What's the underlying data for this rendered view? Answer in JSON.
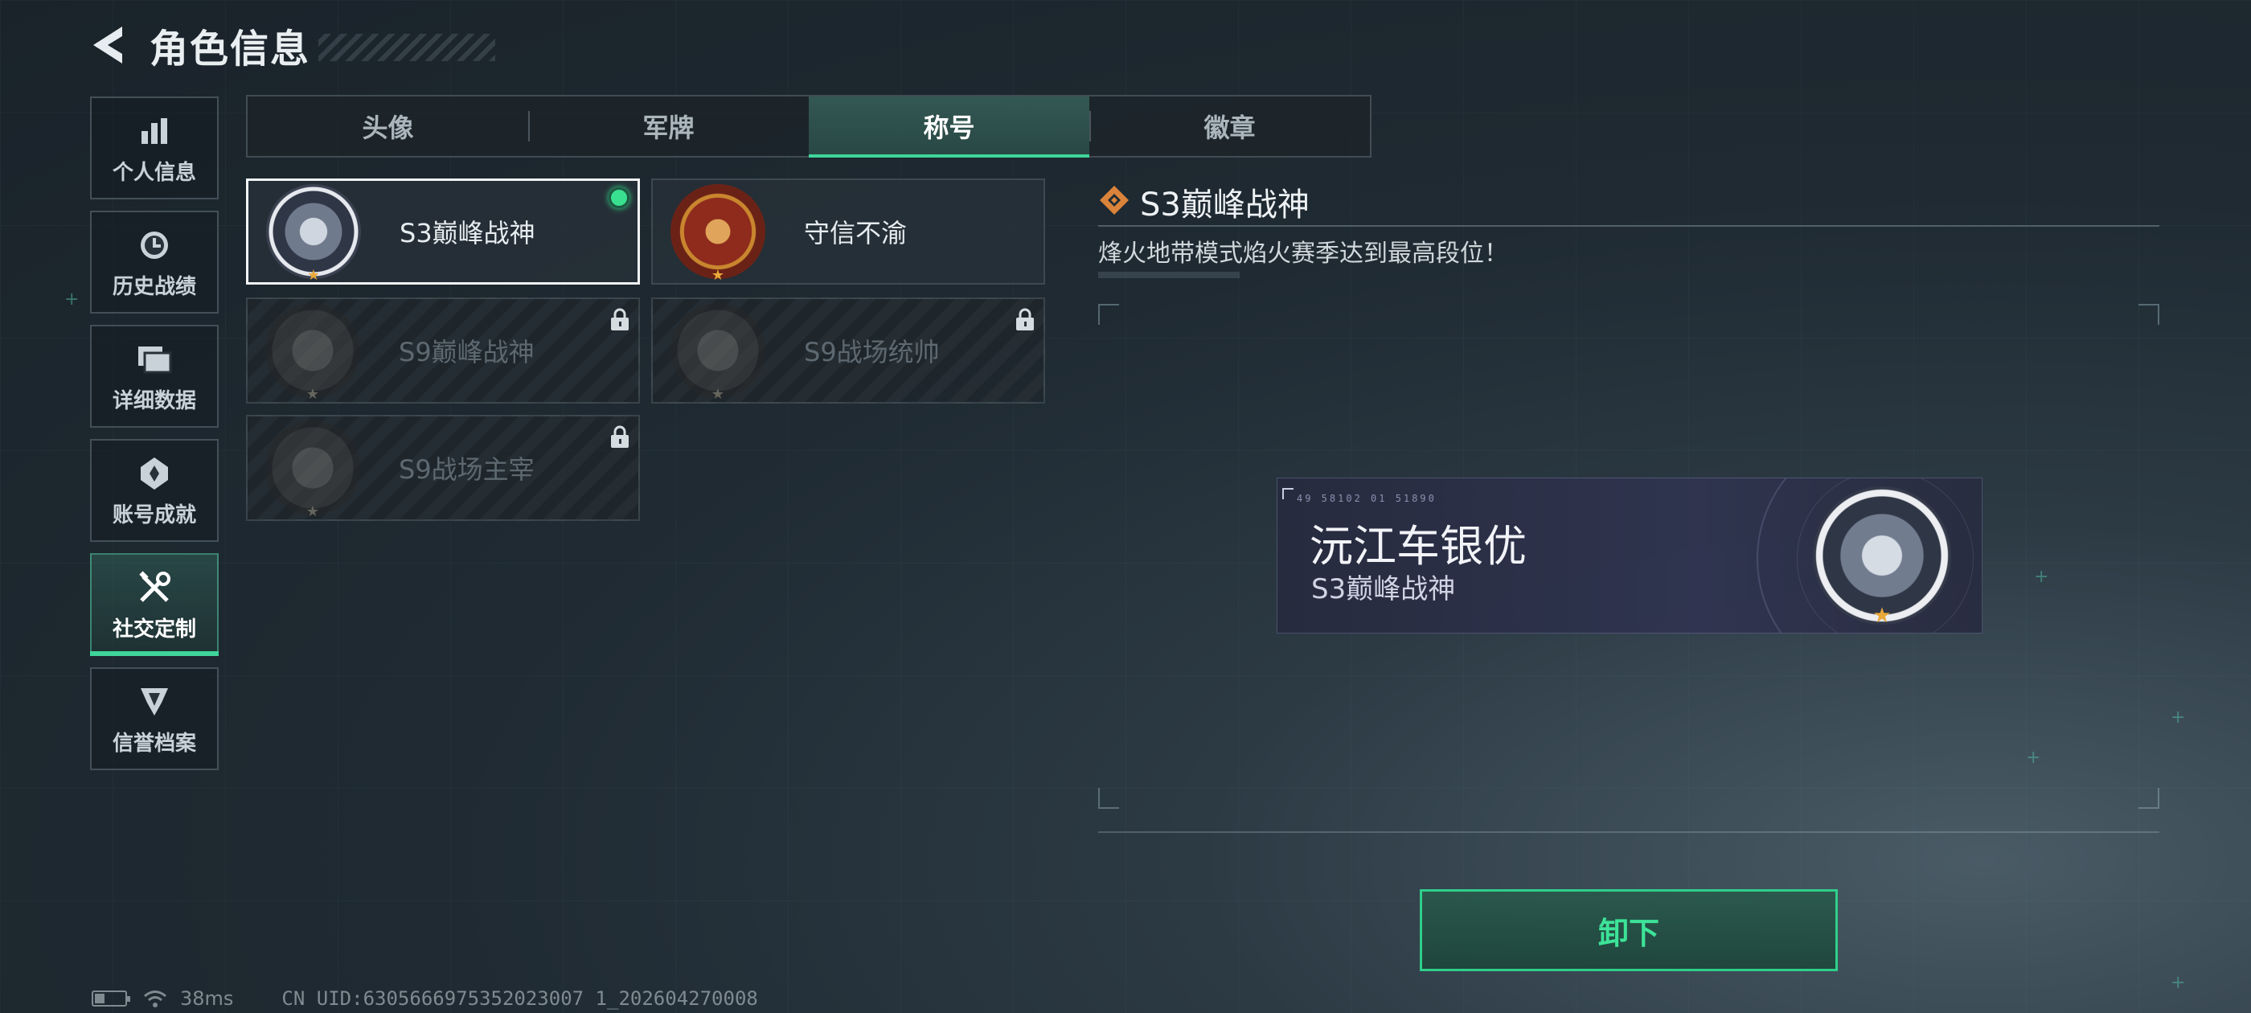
{
  "header": {
    "title": "角色信息",
    "back_icon": "back-arrow-icon"
  },
  "sidebar": {
    "items": [
      {
        "label": "个人信息",
        "icon": "bar-chart-icon",
        "active": false
      },
      {
        "label": "历史战绩",
        "icon": "clock-icon",
        "active": false
      },
      {
        "label": "详细数据",
        "icon": "folder-icon",
        "active": false
      },
      {
        "label": "账号成就",
        "icon": "achievement-icon",
        "active": false
      },
      {
        "label": "社交定制",
        "icon": "tools-icon",
        "active": true
      },
      {
        "label": "信誉档案",
        "icon": "shield-icon",
        "active": false
      }
    ]
  },
  "tabs": [
    {
      "label": "头像",
      "active": false
    },
    {
      "label": "军牌",
      "active": false
    },
    {
      "label": "称号",
      "active": true
    },
    {
      "label": "徽章",
      "active": false
    }
  ],
  "titles": [
    {
      "label": "S3巅峰战神",
      "icon": "armillary-sphere-icon",
      "selected": true,
      "equipped": true,
      "locked": false
    },
    {
      "label": "守信不渝",
      "icon": "scales-icon",
      "selected": false,
      "equipped": false,
      "locked": false
    },
    {
      "label": "S9巅峰战神",
      "icon": "dam-icon",
      "selected": false,
      "equipped": false,
      "locked": true
    },
    {
      "label": "S9战场统帅",
      "icon": "warship-icon",
      "selected": false,
      "equipped": false,
      "locked": true
    },
    {
      "label": "S9战场主宰",
      "icon": "mushroom-cloud-icon",
      "selected": false,
      "equipped": false,
      "locked": true
    }
  ],
  "detail": {
    "title": "S3巅峰战神",
    "description": "烽火地带模式焰火赛季达到最高段位！"
  },
  "nameplate": {
    "code": "49 58102   01 51890",
    "player_name": "沅江车银优",
    "title": "S3巅峰战神"
  },
  "unequip_button": {
    "label": "卸下"
  },
  "status": {
    "ping": "38ms",
    "uid": "CN UID:6305666975352023007 1_202604270008"
  },
  "colors": {
    "accent": "#3fd59a",
    "equipped": "#39e08f",
    "star": "#e8a93a"
  }
}
